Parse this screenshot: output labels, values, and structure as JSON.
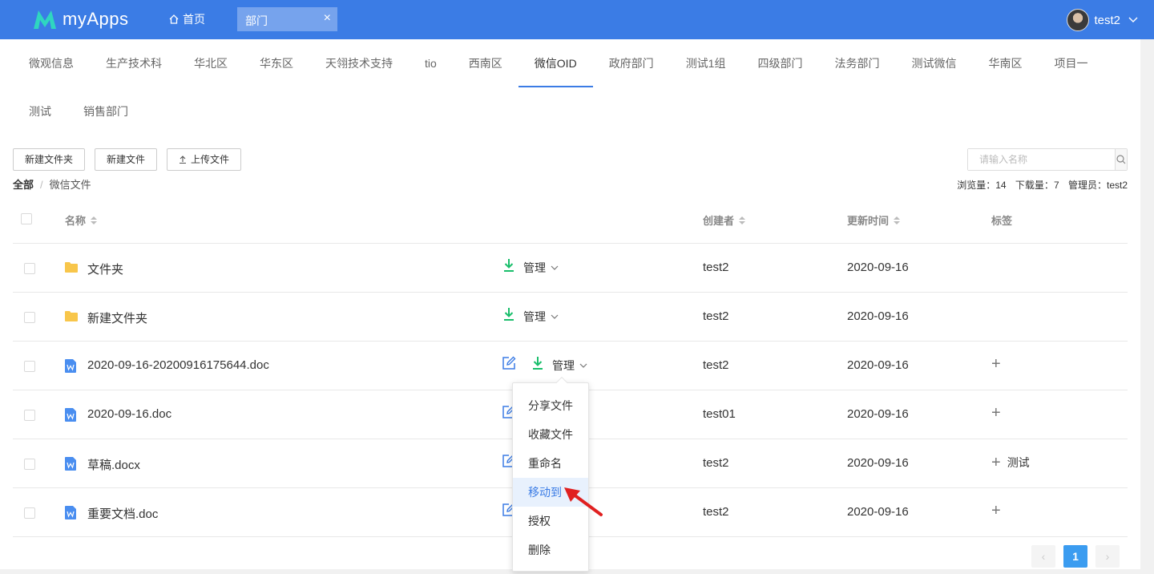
{
  "header": {
    "app_name": "myApps",
    "home_label": "首页",
    "open_tab_label": "部门",
    "close_symbol": "×",
    "user_name": "test2"
  },
  "categories": {
    "row1": [
      "微观信息",
      "生产技术科",
      "华北区",
      "华东区",
      "天翎技术支持",
      "tio",
      "西南区",
      "微信OID",
      "政府部门",
      "测试1组",
      "四级部门",
      "法务部门",
      "测试微信",
      "华南区",
      "项目一"
    ],
    "row2": [
      "测试",
      "销售部门"
    ],
    "active": "微信OID"
  },
  "toolbar": {
    "new_folder": "新建文件夹",
    "new_file": "新建文件",
    "upload": "上传文件",
    "search_placeholder": "请输入名称"
  },
  "breadcrumb": {
    "root": "全部",
    "separator": "/",
    "current": "微信文件"
  },
  "stats": {
    "views_label": "浏览量：",
    "views": "14",
    "downloads_label": "下载量：",
    "downloads": "7",
    "admin_label": "管理员：",
    "admin": "test2"
  },
  "table": {
    "headers": {
      "name": "名称",
      "creator": "创建者",
      "updated": "更新时间",
      "tags": "标签"
    },
    "manage_label": "管理",
    "rows": [
      {
        "type": "folder",
        "name": "文件夹",
        "creator": "test2",
        "date": "2020-09-16",
        "tag": "",
        "show_plus": false,
        "editable": false
      },
      {
        "type": "folder",
        "name": "新建文件夹",
        "creator": "test2",
        "date": "2020-09-16",
        "tag": "",
        "show_plus": false,
        "editable": false
      },
      {
        "type": "doc",
        "name": "2020-09-16-20200916175644.doc",
        "creator": "test2",
        "date": "2020-09-16",
        "tag": "",
        "show_plus": true,
        "editable": true
      },
      {
        "type": "doc",
        "name": "2020-09-16.doc",
        "creator": "test01",
        "date": "2020-09-16",
        "tag": "",
        "show_plus": true,
        "editable": true
      },
      {
        "type": "doc",
        "name": "草稿.docx",
        "creator": "test2",
        "date": "2020-09-16",
        "tag": "测试",
        "show_plus": true,
        "editable": true
      },
      {
        "type": "doc",
        "name": "重要文档.doc",
        "creator": "test2",
        "date": "2020-09-16",
        "tag": "",
        "show_plus": true,
        "editable": true
      }
    ]
  },
  "dropdown": {
    "items": [
      "分享文件",
      "收藏文件",
      "重命名",
      "移动到",
      "授权",
      "删除"
    ],
    "highlighted": "移动到"
  },
  "pagination": {
    "prev": "‹",
    "current": "1",
    "next": "›"
  },
  "colors": {
    "primary": "#3b7ce5",
    "download_green": "#19be6b",
    "folder_yellow": "#f8c64b",
    "doc_blue": "#4a8ef0",
    "arrow_red": "#e02020"
  }
}
